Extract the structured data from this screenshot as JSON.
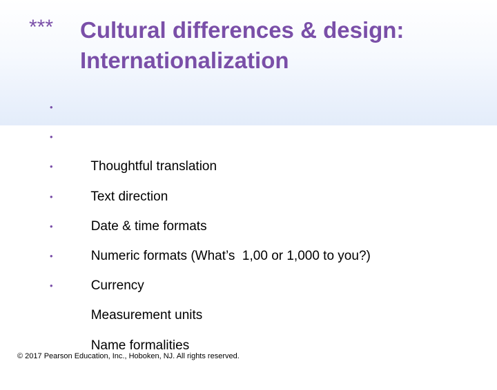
{
  "slide": {
    "marker": "***",
    "title_line1": "Cultural differences & design:",
    "title_line2": "Internationalization",
    "bullet_symbol": "•",
    "bullets": [
      "Thoughtful translation",
      "Text direction",
      "Date & time formats",
      "Numeric formats (What’s  1,00 or 1,000 to you?)",
      "Currency",
      "Measurement units",
      "Name formalities"
    ],
    "footer": "© 2017 Pearson Education, Inc., Hoboken, NJ.  All rights reserved."
  },
  "colors": {
    "title": "#7a4fa8",
    "bullet_marker": "#7a4fa8",
    "body_text": "#000000",
    "title_band_bottom": "#e3ecfa"
  }
}
